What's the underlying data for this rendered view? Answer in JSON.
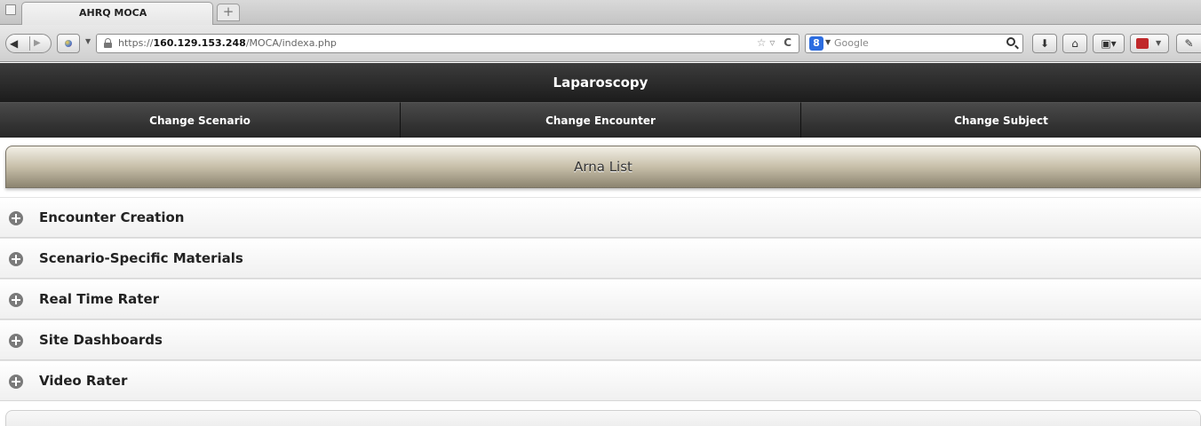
{
  "browser": {
    "tab_title": "AHRQ MOCA",
    "new_tab_symbol": "+",
    "url_prefix": "https://",
    "url_host": "160.129.153.248",
    "url_path": "/MOCA/indexa.php",
    "search_engine_letter": "8",
    "search_placeholder": "Google",
    "back_symbol": "◀",
    "forward_symbol": "▶",
    "reload_symbol": "C",
    "star_symbol": "☆ ▿",
    "download_symbol": "⬇",
    "home_symbol": "⌂",
    "bookmark_symbol": "▣▾",
    "tools_symbol": "✎"
  },
  "header": {
    "title": "Laparoscopy"
  },
  "nav": {
    "items": [
      {
        "label": "Change Scenario"
      },
      {
        "label": "Change Encounter"
      },
      {
        "label": "Change Subject"
      }
    ]
  },
  "list": {
    "divider_title": "Arna List",
    "items": [
      {
        "label": "Encounter Creation",
        "icon": "plus-circle-icon"
      },
      {
        "label": "Scenario-Specific Materials",
        "icon": "plus-circle-icon"
      },
      {
        "label": "Real Time Rater",
        "icon": "plus-circle-icon"
      },
      {
        "label": "Site Dashboards",
        "icon": "plus-circle-icon"
      },
      {
        "label": "Video Rater",
        "icon": "plus-circle-icon"
      }
    ]
  },
  "colors": {
    "header_bg": "#2a2a2a",
    "divider_bg": "#b8af98",
    "list_bg": "#f5f5f5",
    "icon_gray": "#7a7a7a"
  }
}
